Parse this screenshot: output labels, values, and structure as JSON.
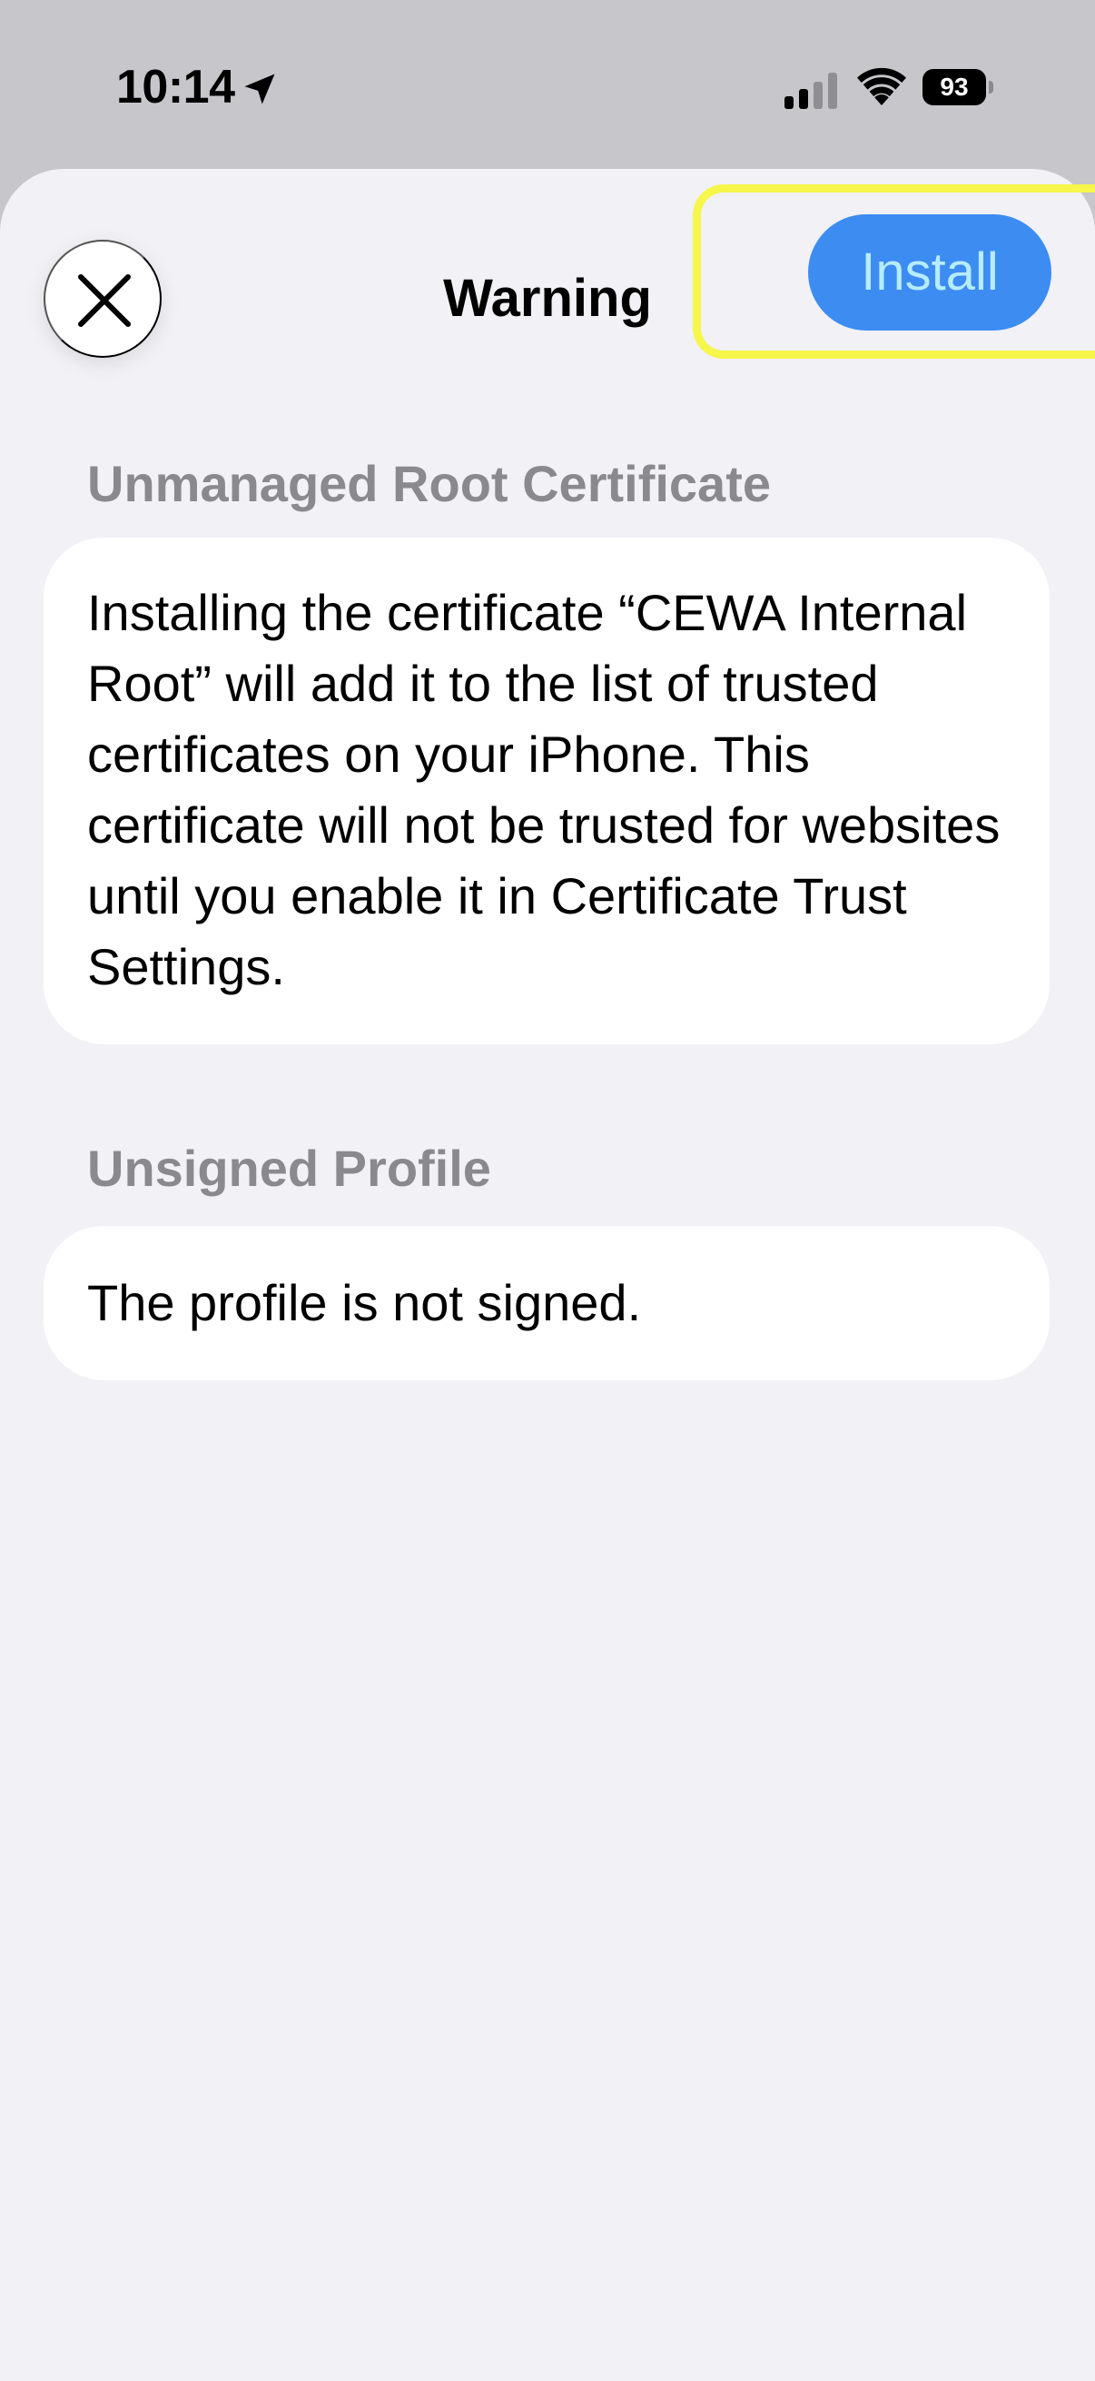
{
  "status_bar": {
    "time": "10:14",
    "battery_percent": "93",
    "icons": [
      "location-arrow-icon",
      "cellular-signal-icon",
      "wifi-icon",
      "battery-icon"
    ]
  },
  "sheet": {
    "title": "Warning",
    "install_label": "Install",
    "close_icon": "close-x-icon"
  },
  "sections": [
    {
      "header": "Unmanaged Root Certificate",
      "body": "Installing the certificate “CEWA Internal Root” will add it to the list of trusted certificates on your iPhone. This certificate will not be trusted for websites until you enable it in Certificate Trust Settings."
    },
    {
      "header": "Unsigned Profile",
      "body": "The profile is not signed."
    }
  ],
  "colors": {
    "install_button_bg": "#3c8cf2",
    "install_button_text": "#b6ecff",
    "highlight": "#f6f64b",
    "sheet_bg": "#f1f1f6",
    "section_header": "#8a8a8e"
  }
}
